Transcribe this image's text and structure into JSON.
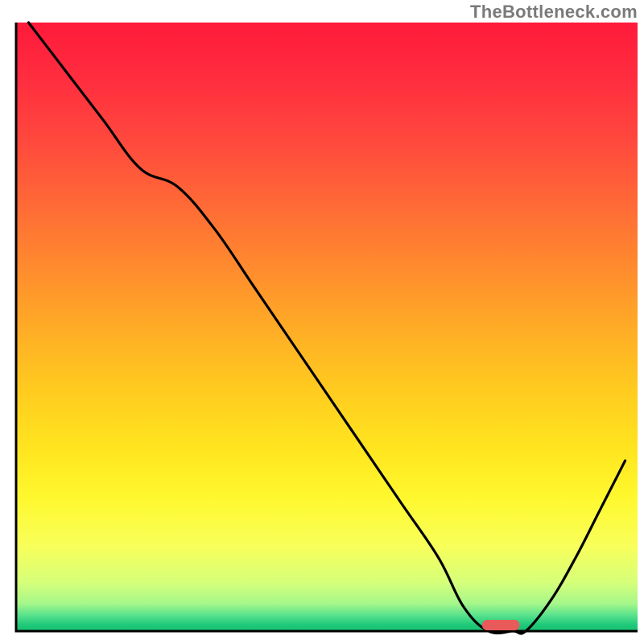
{
  "watermark": "TheBottleneck.com",
  "chart_data": {
    "type": "line",
    "title": "",
    "xlabel": "",
    "ylabel": "",
    "xlim": [
      0,
      100
    ],
    "ylim": [
      0,
      100
    ],
    "series": [
      {
        "name": "bottleneck-curve",
        "x": [
          2,
          8,
          14,
          20,
          26,
          32,
          38,
          44,
          50,
          56,
          62,
          68,
          72,
          76,
          80,
          82,
          86,
          90,
          94,
          98
        ],
        "y": [
          100,
          92,
          84,
          76,
          73,
          66,
          57,
          48,
          39,
          30,
          21,
          12,
          4,
          0,
          0,
          0,
          5,
          12,
          20,
          28
        ]
      }
    ],
    "marker": {
      "name": "optimal-range-marker",
      "x_center": 78,
      "y": 0,
      "width": 6,
      "color": "#e95a5a"
    },
    "gradient_stops": [
      {
        "offset": 0.0,
        "color": "#ff1a3a"
      },
      {
        "offset": 0.1,
        "color": "#ff2f3f"
      },
      {
        "offset": 0.2,
        "color": "#ff4a3d"
      },
      {
        "offset": 0.3,
        "color": "#ff6a36"
      },
      {
        "offset": 0.4,
        "color": "#ff8a2e"
      },
      {
        "offset": 0.5,
        "color": "#ffab26"
      },
      {
        "offset": 0.6,
        "color": "#ffca1f"
      },
      {
        "offset": 0.7,
        "color": "#ffe51f"
      },
      {
        "offset": 0.78,
        "color": "#fff82e"
      },
      {
        "offset": 0.86,
        "color": "#f8ff5a"
      },
      {
        "offset": 0.92,
        "color": "#d6ff7a"
      },
      {
        "offset": 0.955,
        "color": "#a5f78a"
      },
      {
        "offset": 0.975,
        "color": "#55e08c"
      },
      {
        "offset": 0.99,
        "color": "#1ec97a"
      },
      {
        "offset": 1.0,
        "color": "#18c06f"
      }
    ],
    "axes": {
      "stroke": "#000000",
      "stroke_width": 3
    },
    "grid": false,
    "legend": false
  }
}
